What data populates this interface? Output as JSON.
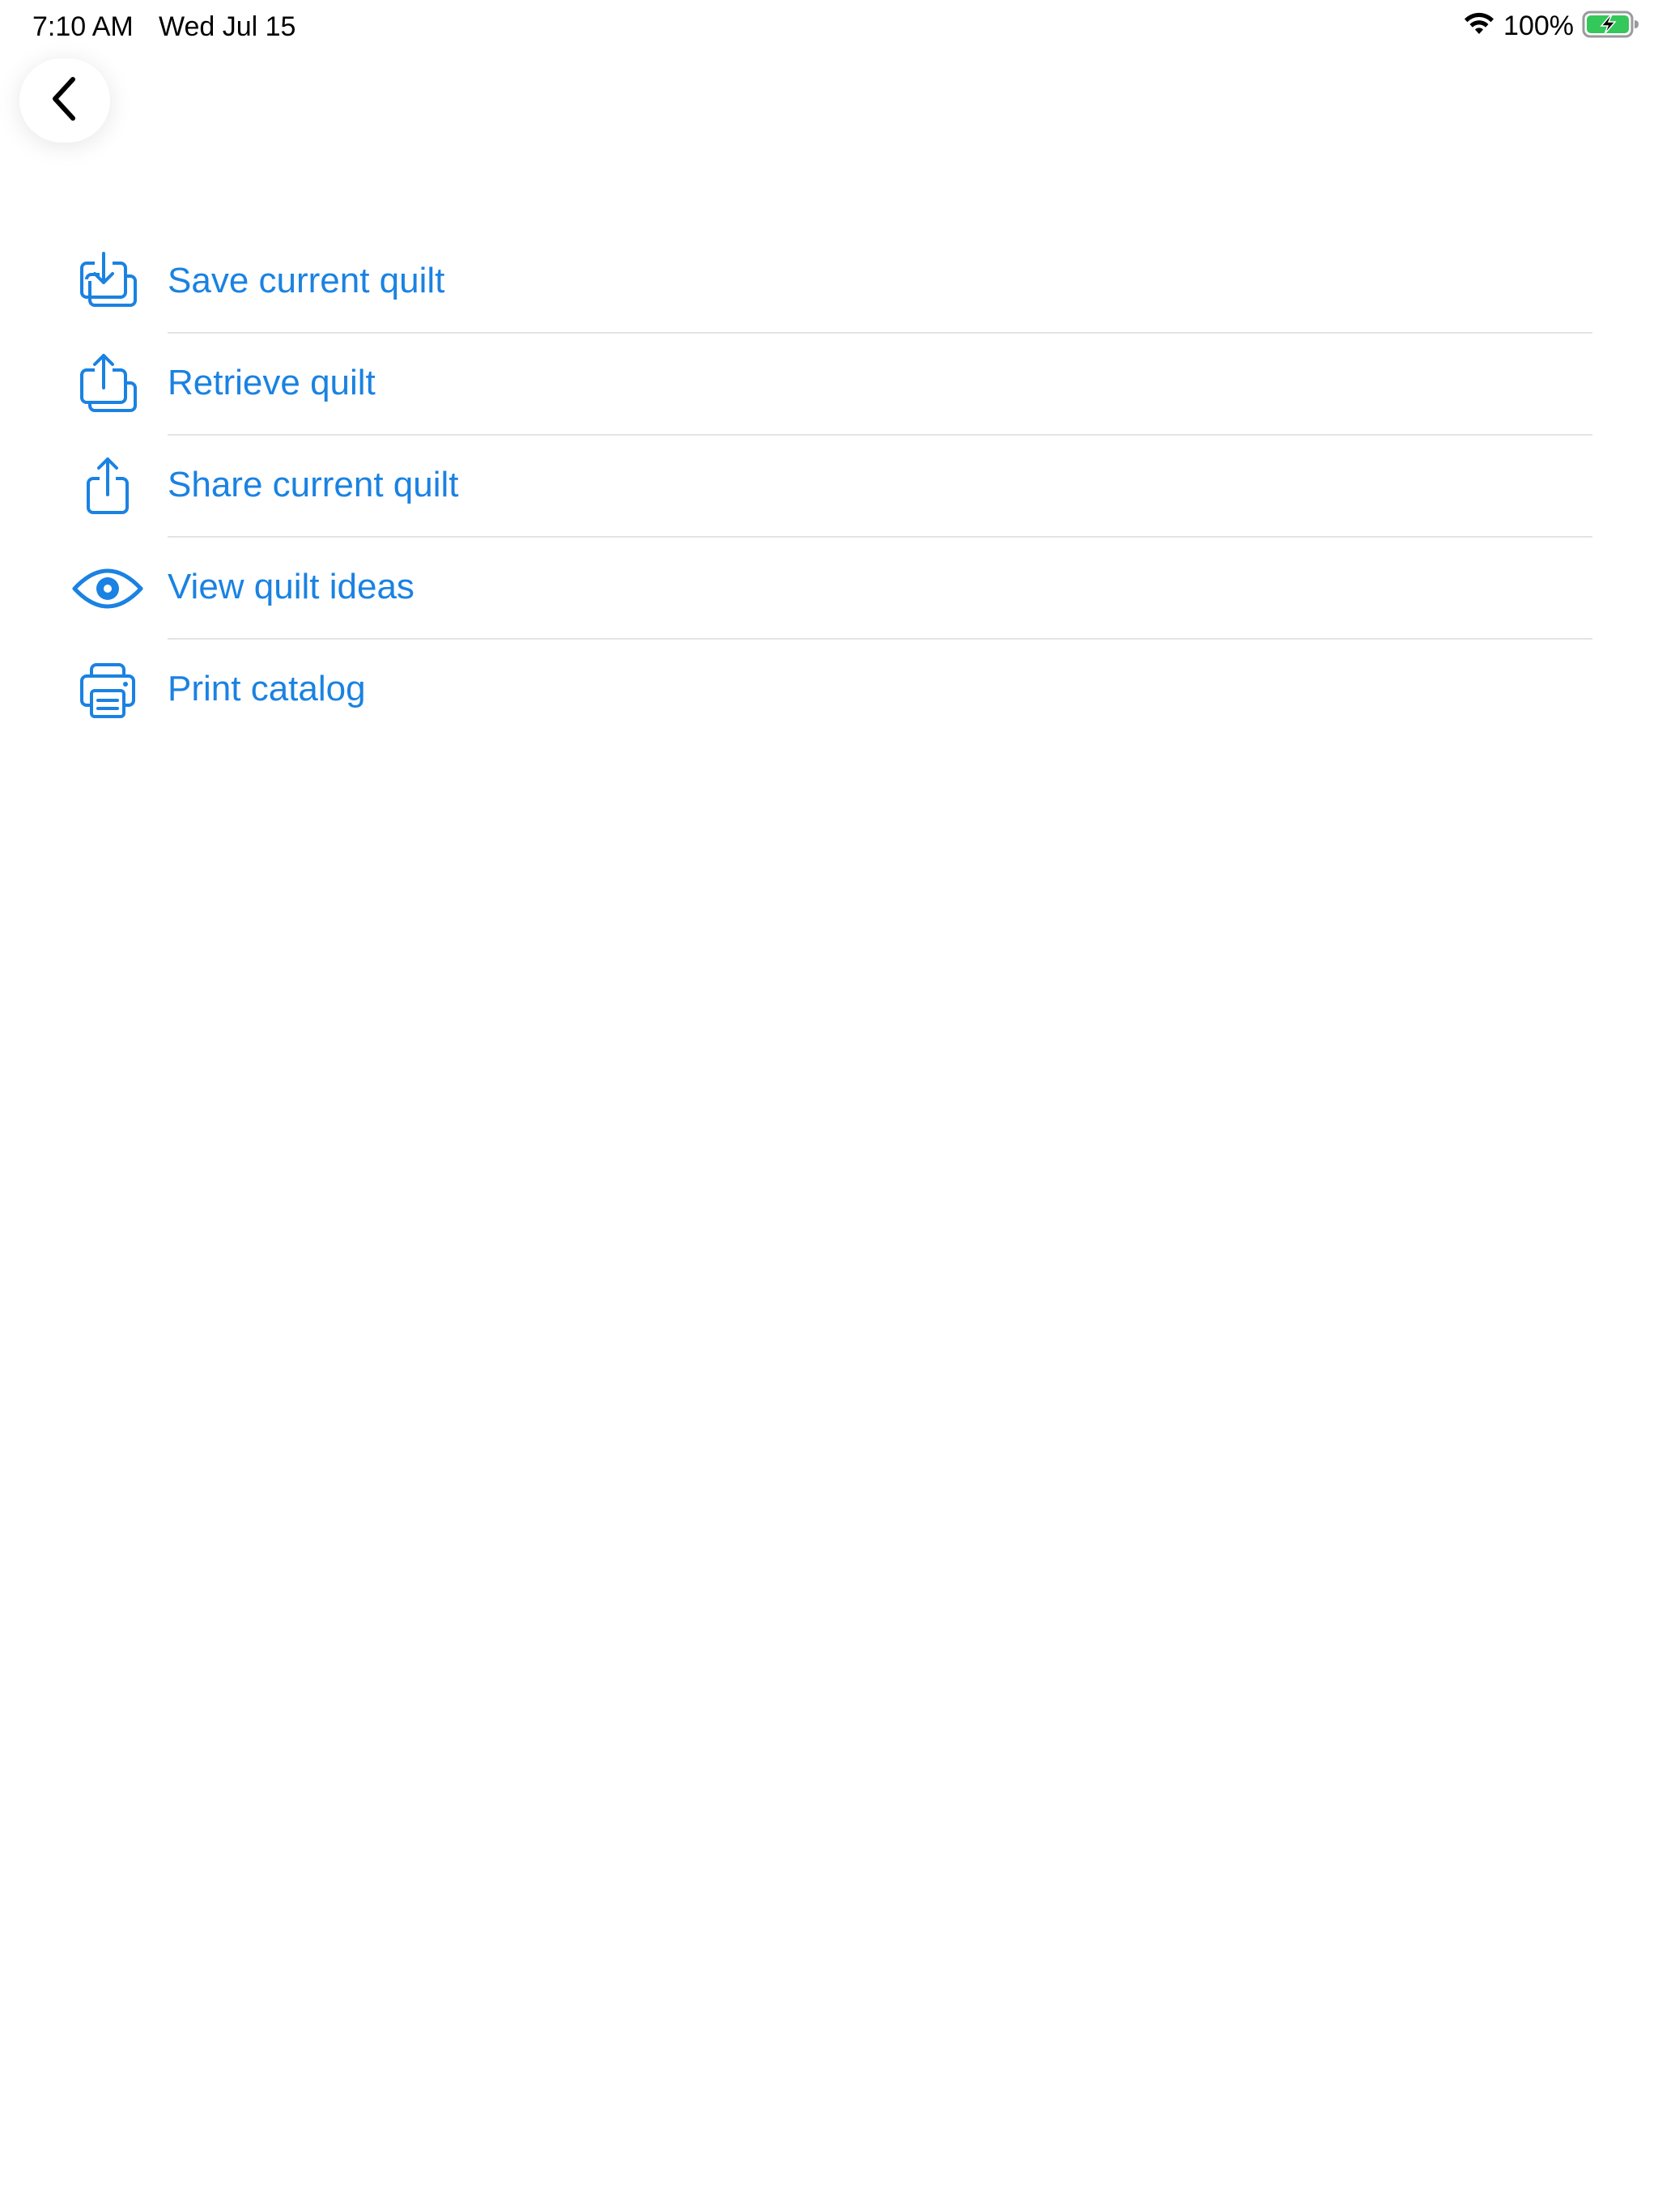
{
  "status_bar": {
    "time": "7:10 AM",
    "date": "Wed Jul 15",
    "battery_percent": "100%",
    "battery_level": 1.0,
    "charging": true,
    "wifi_icon": "wifi-icon",
    "battery_icon": "battery-charging-icon"
  },
  "navigation": {
    "back_icon": "chevron-left-icon"
  },
  "menu": {
    "items": [
      {
        "label": "Save current quilt",
        "icon": "save-download-icon"
      },
      {
        "label": "Retrieve quilt",
        "icon": "retrieve-upload-icon"
      },
      {
        "label": "Share current quilt",
        "icon": "share-icon"
      },
      {
        "label": "View quilt ideas",
        "icon": "eye-icon"
      },
      {
        "label": "Print catalog",
        "icon": "printer-icon"
      }
    ]
  },
  "colors": {
    "accent": "#1a82e2",
    "divider": "#e4e4e6",
    "battery_fill": "#34c759"
  }
}
